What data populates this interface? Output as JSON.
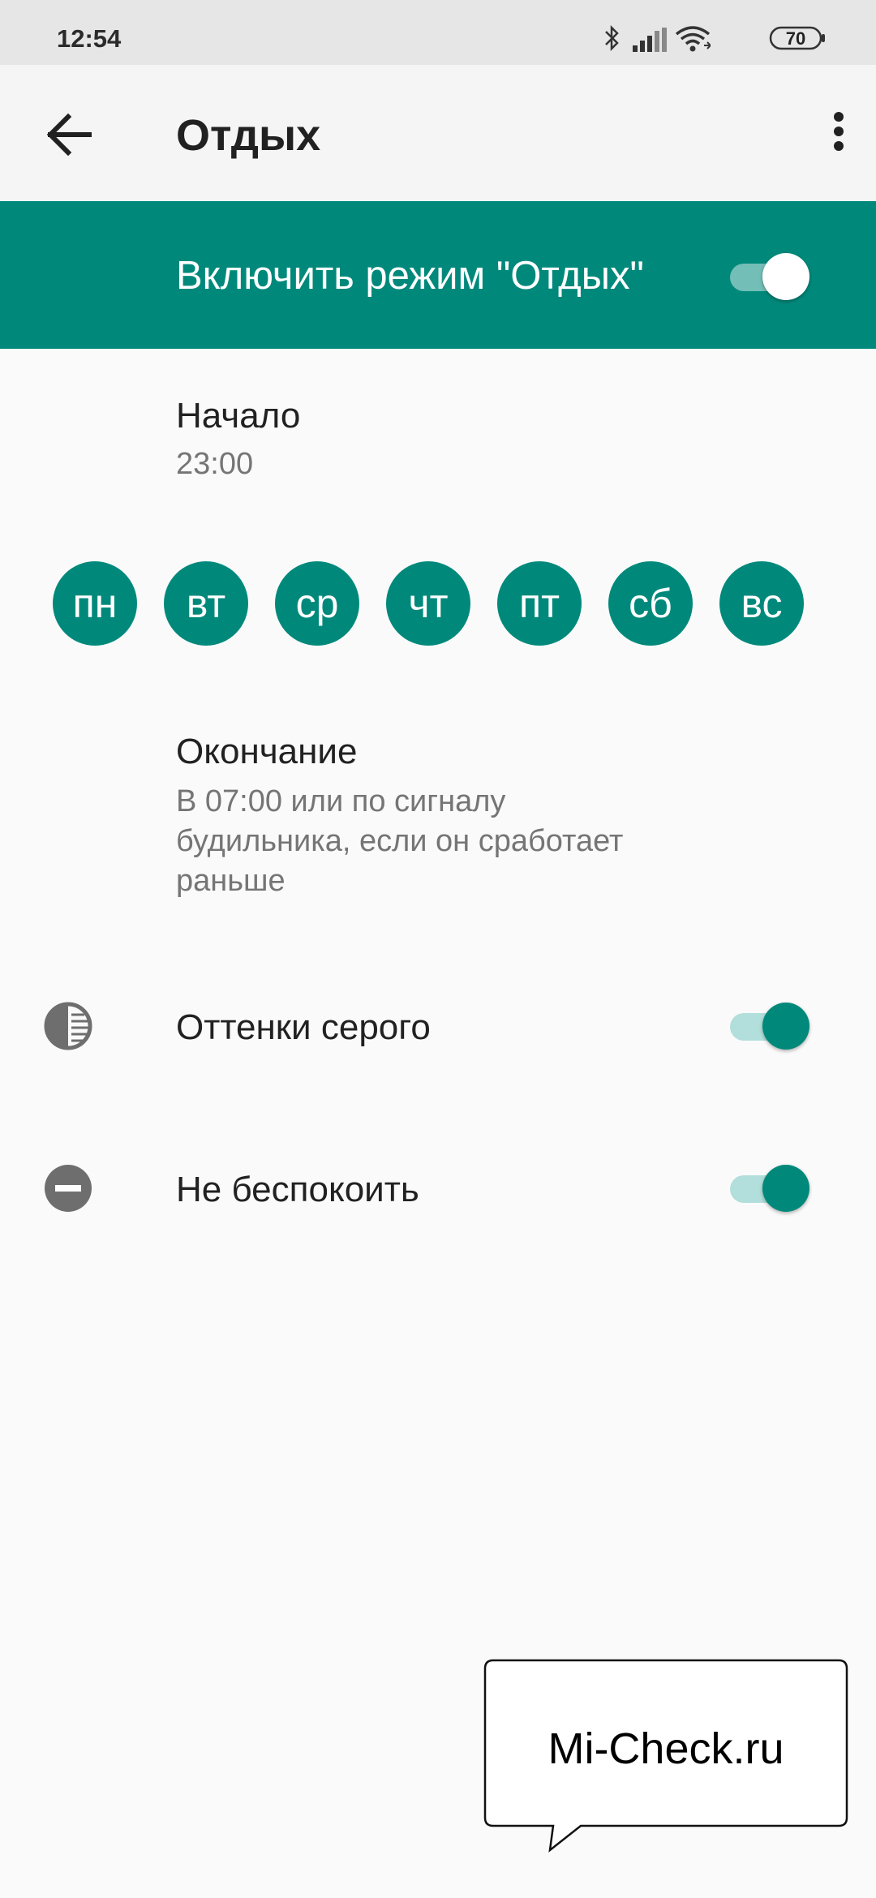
{
  "status_bar": {
    "time": "12:54",
    "battery": "70"
  },
  "app_bar": {
    "title": "Отдых",
    "back_icon": "arrow-left-icon",
    "menu_icon": "more-vert-icon"
  },
  "banner": {
    "label": "Включить режим \"Отдых\"",
    "enabled": true
  },
  "start": {
    "title": "Начало",
    "value": "23:00"
  },
  "days": [
    "пн",
    "вт",
    "ср",
    "чт",
    "пт",
    "сб",
    "вс"
  ],
  "end": {
    "title": "Окончание",
    "lines": [
      "В 07:00 или по сигналу",
      "будильника, если он сработает",
      "раньше"
    ]
  },
  "grayscale": {
    "label": "Оттенки серого",
    "enabled": true,
    "icon": "grayscale-icon"
  },
  "dnd": {
    "label": "Не беспокоить",
    "enabled": true,
    "icon": "do-not-disturb-icon"
  },
  "watermark": {
    "text": "Mi-Check.ru"
  },
  "colors": {
    "accent": "#00897b",
    "accent_light": "#b2dfdb",
    "background": "#fafafa",
    "status_bar": "#e6e6e6"
  }
}
